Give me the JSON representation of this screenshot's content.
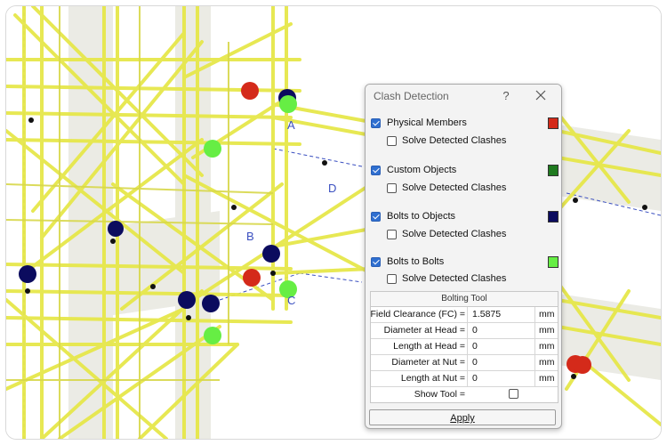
{
  "dialog": {
    "title": "Clash Detection",
    "help": "?",
    "sections": [
      {
        "label": "Physical Members",
        "checked": true,
        "color": "#d42a1a",
        "solve_label": "Solve Detected Clashes",
        "solve_checked": false
      },
      {
        "label": "Custom Objects",
        "checked": true,
        "color": "#1f7a1f",
        "solve_label": "Solve Detected Clashes",
        "solve_checked": false
      },
      {
        "label": "Bolts to Objects",
        "checked": true,
        "color": "#0b0b5e",
        "solve_label": "Solve Detected Clashes",
        "solve_checked": false
      },
      {
        "label": "Bolts to Bolts",
        "checked": true,
        "color": "#66ee44",
        "solve_label": "Solve Detected Clashes",
        "solve_checked": false
      }
    ],
    "bolting_tool": {
      "title": "Bolting Tool",
      "rows": [
        {
          "label": "Field Clearance (FC) =",
          "value": "1.5875",
          "unit": "mm"
        },
        {
          "label": "Diameter at Head =",
          "value": "0",
          "unit": "mm"
        },
        {
          "label": "Length at Head =",
          "value": "0",
          "unit": "mm"
        },
        {
          "label": "Diameter at Nut =",
          "value": "0",
          "unit": "mm"
        },
        {
          "label": "Length at Nut =",
          "value": "0",
          "unit": "mm"
        }
      ],
      "show_tool_label": "Show Tool =",
      "show_tool_checked": false
    },
    "apply_label": "Apply"
  },
  "viewport": {
    "labels": [
      "A",
      "B",
      "C",
      "D"
    ],
    "member_color": "#e9ea4a",
    "clash_colors": {
      "physical": "#d42a1a",
      "custom": "#66ee44",
      "bolts_objects": "#0b0b5e"
    }
  }
}
